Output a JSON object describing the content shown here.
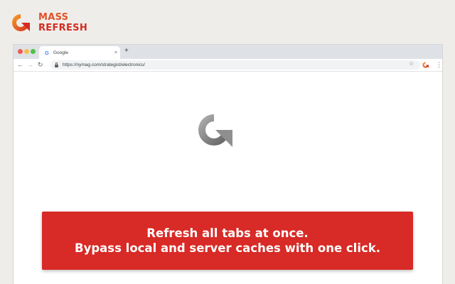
{
  "brand": {
    "line1": "MASS",
    "line2": "REFRESH",
    "logo_icon": "refresh-arrow-icon",
    "colors": {
      "orange": "#f2922a",
      "red": "#d42b20"
    }
  },
  "browser": {
    "tab": {
      "favicon": "G",
      "title": "Google",
      "close": "×"
    },
    "new_tab": "+",
    "toolbar": {
      "back": "←",
      "forward": "→",
      "reload": "↻",
      "url": "https://nymag.com/strategist/electronics/",
      "star": "☆",
      "menu": "⋮"
    }
  },
  "content": {
    "icon": "refresh-arrow-icon"
  },
  "banner": {
    "line1": "Refresh all tabs at once.",
    "line2": "Bypass local and server caches with one click.",
    "color": "#d82a26"
  }
}
